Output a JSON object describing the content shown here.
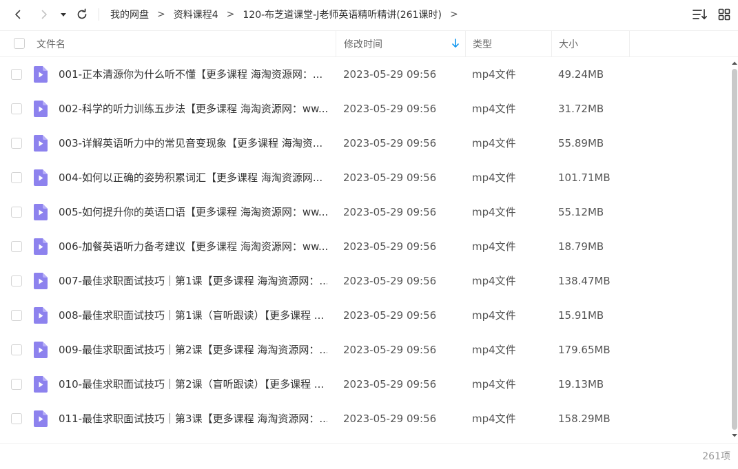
{
  "nav": {
    "back_icon": "arrow-left-icon",
    "forward_icon": "arrow-right-icon",
    "dropdown_icon": "caret-down-icon",
    "refresh_icon": "refresh-icon"
  },
  "breadcrumb": {
    "items": [
      "我的网盘",
      "资料课程4",
      "120-布芝道课堂-J老师英语精听精讲(261课时)"
    ],
    "separator": ">"
  },
  "toolbar": {
    "sort_icon": "sort-list-icon",
    "view_icon": "grid-view-icon"
  },
  "header": {
    "name": "文件名",
    "time": "修改时间",
    "type": "类型",
    "size": "大小",
    "sort_icon": "arrow-down-icon"
  },
  "colors": {
    "accent": "#1a9bf0",
    "file_icon": "#8d82ee",
    "file_icon_fold": "#b7aff7"
  },
  "files": [
    {
      "name": "001-正本清源你为什么听不懂【更多课程 海淘资源网：...",
      "time": "2023-05-29 09:56",
      "type": "mp4文件",
      "size": "49.24MB"
    },
    {
      "name": "002-科学的听力训练五步法【更多课程 海淘资源网：ww...",
      "time": "2023-05-29 09:56",
      "type": "mp4文件",
      "size": "31.72MB"
    },
    {
      "name": "003-详解英语听力中的常见音变现象【更多课程 海淘资...",
      "time": "2023-05-29 09:56",
      "type": "mp4文件",
      "size": "55.89MB"
    },
    {
      "name": "004-如何以正确的姿势积累词汇【更多课程 海淘资源网...",
      "time": "2023-05-29 09:56",
      "type": "mp4文件",
      "size": "101.71MB"
    },
    {
      "name": "005-如何提升你的英语口语【更多课程 海淘资源网：ww...",
      "time": "2023-05-29 09:56",
      "type": "mp4文件",
      "size": "55.12MB"
    },
    {
      "name": "006-加餐英语听力备考建议【更多课程 海淘资源网：ww...",
      "time": "2023-05-29 09:56",
      "type": "mp4文件",
      "size": "18.79MB"
    },
    {
      "name": "007-最佳求职面试技巧｜第1课【更多课程 海淘资源网：...",
      "time": "2023-05-29 09:56",
      "type": "mp4文件",
      "size": "138.47MB"
    },
    {
      "name": "008-最佳求职面试技巧｜第1课（盲听跟读）【更多课程 ...",
      "time": "2023-05-29 09:56",
      "type": "mp4文件",
      "size": "15.91MB"
    },
    {
      "name": "009-最佳求职面试技巧｜第2课【更多课程 海淘资源网：...",
      "time": "2023-05-29 09:56",
      "type": "mp4文件",
      "size": "179.65MB"
    },
    {
      "name": "010-最佳求职面试技巧｜第2课（盲听跟读）【更多课程 ...",
      "time": "2023-05-29 09:56",
      "type": "mp4文件",
      "size": "19.13MB"
    },
    {
      "name": "011-最佳求职面试技巧｜第3课【更多课程 海淘资源网：...",
      "time": "2023-05-29 09:56",
      "type": "mp4文件",
      "size": "158.29MB"
    }
  ],
  "footer": {
    "count": "261项"
  }
}
